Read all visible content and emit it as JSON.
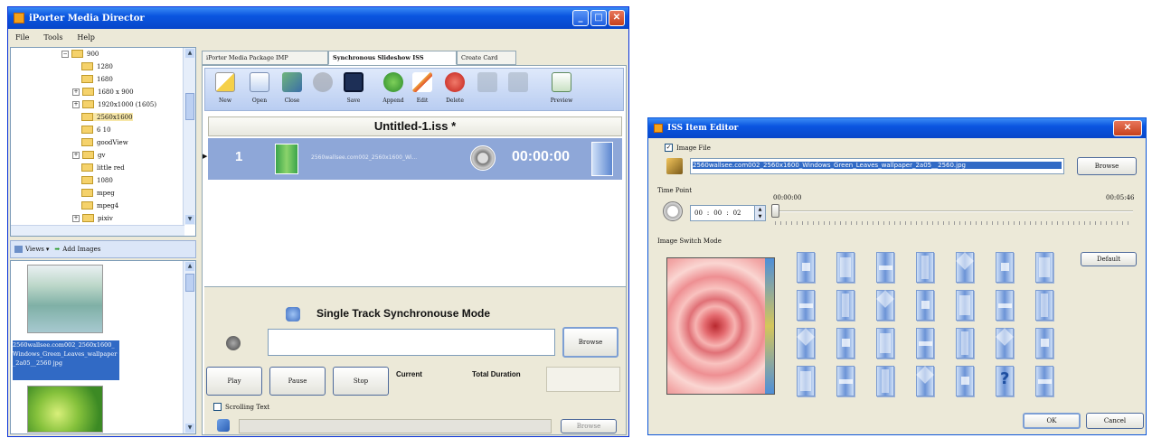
{
  "main_window": {
    "title": "iPorter Media Director",
    "menu": [
      "File",
      "Tools",
      "Help"
    ],
    "tree_items": [
      "900",
      "1280",
      "1680",
      "1680 x 900",
      "1920x1000  (1605)",
      "2560x1600",
      "6 10",
      "goodView",
      "gv",
      "little       red",
      "1080",
      "mpeg",
      "mpeg4",
      "pixiv"
    ],
    "bottom_toolbar": {
      "views_label": "Views",
      "add_images_label": "Add Images"
    },
    "thumbnail_caption": "2560wallsee.com002_2560x1600_Windows_Green_Leaves_wallpaper_2a05__2560 jpg",
    "tabs": [
      "iPorter Media Package IMP",
      "Synchronous Slideshow ISS",
      "Create Card"
    ],
    "toolbar": [
      "New",
      "Open",
      "Close",
      "",
      "Save",
      "Append",
      "Edit",
      "Delete",
      "",
      "",
      "Preview"
    ],
    "doc_title": "Untitled-1.iss *",
    "track": {
      "index": "1",
      "filename": "2560wallsee.com002_2560x1600_Wi...",
      "time": "00:00:00"
    },
    "mode_title": "Single Track Synchronouse Mode",
    "browse_label": "Browse",
    "playback": [
      "Play",
      "Pause",
      "Stop"
    ],
    "current_label": "Current",
    "total_label": "Total Duration",
    "scrolling_text_label": "Scrolling Text",
    "browse2_label": "Browse"
  },
  "dialog": {
    "title": "ISS Item Editor",
    "image_file_label": "Image File",
    "image_path": "2560wallsee.com002_2560x1600_Windows_Green_Leaves_wallpaper_2a05__2560.jpg",
    "browse_label": "Browse",
    "time_point_label": "Time Point",
    "time_fields": [
      "00",
      "00",
      "02"
    ],
    "time_current": "00:00:00",
    "time_total": "00:05:46",
    "slider_fraction": 0.0,
    "switch_mode_label": "Image Switch Mode",
    "default_label": "Default",
    "ok_label": "OK",
    "cancel_label": "Cancel",
    "effects_count": 28
  },
  "colors": {
    "accent": "#0a55e0",
    "selection": "#316ac5",
    "track_bg": "#8ea7d8"
  }
}
